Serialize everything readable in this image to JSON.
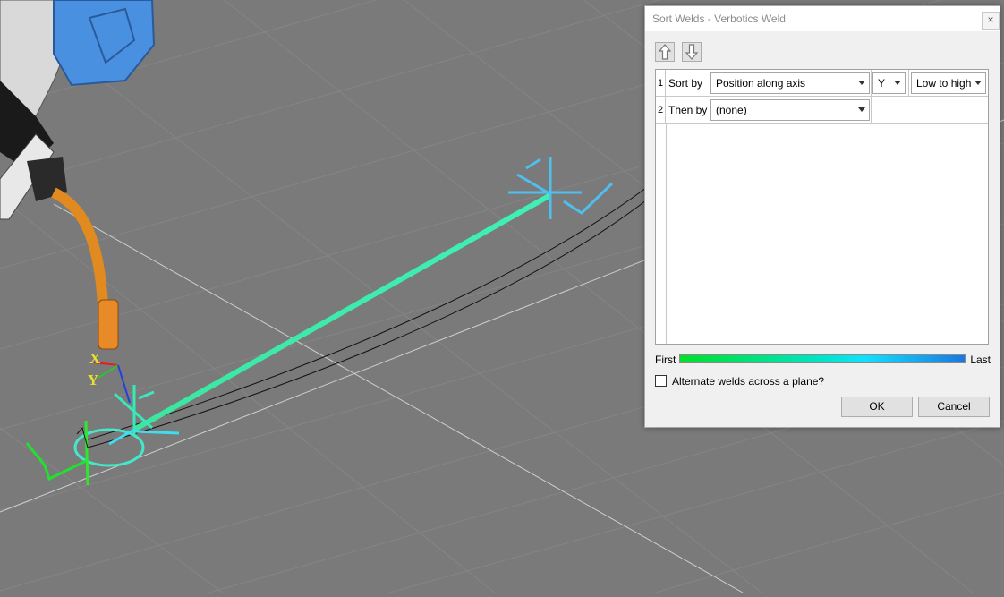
{
  "viewport": {
    "axis_x_label": "X",
    "axis_y_label": "Y"
  },
  "dialog": {
    "title": "Sort Welds - Verbotics Weld",
    "close_symbol": "×",
    "move_up_icon": "arrow-up-icon",
    "move_down_icon": "arrow-down-icon",
    "rows": [
      {
        "number": "1",
        "label": "Sort by",
        "criterion": "Position along axis",
        "axis": "Y",
        "order": "Low to high"
      },
      {
        "number": "2",
        "label": "Then by",
        "criterion": "(none)"
      }
    ],
    "gradient": {
      "first_label": "First",
      "last_label": "Last",
      "start_color": "#00e02a",
      "end_color": "#1a78e0"
    },
    "alternate_checkbox": {
      "label": "Alternate welds across a plane?",
      "checked": false
    },
    "ok_label": "OK",
    "cancel_label": "Cancel"
  }
}
